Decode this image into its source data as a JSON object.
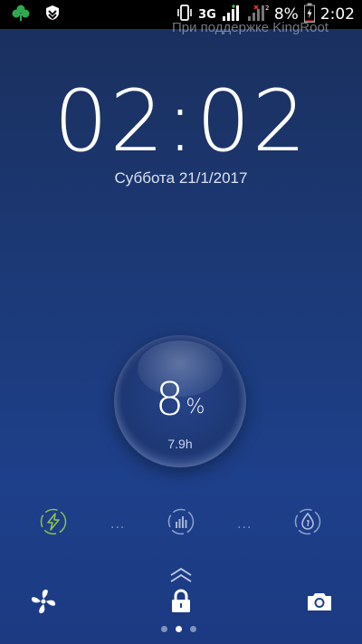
{
  "statusbar": {
    "network": "3G",
    "battery_text": "8%",
    "time": "2:02",
    "left_icons": [
      "clover-icon",
      "shield-download-icon"
    ],
    "right_icons": [
      "vibrate-icon",
      "signal-icon",
      "sim2-signal-icon",
      "battery-icon"
    ]
  },
  "banner": {
    "text": "При поддержке KingRoot"
  },
  "lockscreen": {
    "clock": "02:02",
    "date": "Суббота 21/1/2017"
  },
  "battery": {
    "percent_value": "8",
    "percent_unit": "%",
    "level": 0.08,
    "time_left": "7.9h"
  },
  "charge_stages": {
    "separator": "...",
    "items": [
      "lightning-stage-icon",
      "bars-stage-icon",
      "trickle-stage-icon"
    ],
    "active_color": "#8bc34a"
  },
  "bottom": {
    "unlock_icon": "lock-icon",
    "left_shortcut": "fan-icon",
    "right_shortcut": "camera-icon",
    "pages": 3,
    "active_page": 2
  }
}
